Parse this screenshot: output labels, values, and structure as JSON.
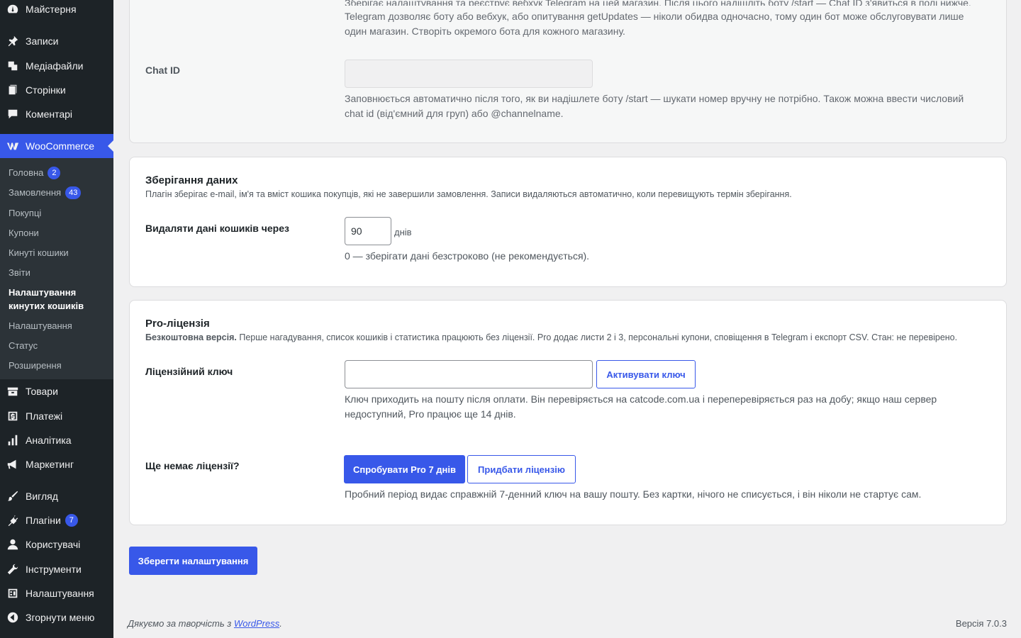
{
  "menu": {
    "dashboard": "Майстерня",
    "posts": "Записи",
    "media": "Медіафайли",
    "pages": "Сторінки",
    "comments": "Коментарі",
    "woocommerce": "WooCommerce",
    "woo_sub": [
      {
        "label": "Головна",
        "badge": "2"
      },
      {
        "label": "Замовлення",
        "badge": "43"
      },
      {
        "label": "Покупці"
      },
      {
        "label": "Купони"
      },
      {
        "label": "Кинуті кошики"
      },
      {
        "label": "Звіти"
      },
      {
        "label": "Налаштування кинутих кошиків",
        "line1": "Налаштування",
        "line2": "кинутих кошиків"
      },
      {
        "label": "Налаштування"
      },
      {
        "label": "Статус"
      },
      {
        "label": "Розширення"
      }
    ],
    "products": "Товари",
    "payments": "Платежі",
    "analytics": "Аналітика",
    "marketing": "Маркетинг",
    "appearance": "Вигляд",
    "plugins": "Плагіни",
    "plugins_badge": "7",
    "users": "Користувачі",
    "tools": "Інструменти",
    "settings": "Налаштування",
    "collapse": "Згорнути меню"
  },
  "telegram": {
    "top_desc_line0": "Зберігає налаштування та реєструє вебхук Telegram на цей магазин. Після цього надішліть боту /start — Chat ID з'явиться в полі нижче.",
    "top_desc_line1": "Telegram дозволяє боту або вебхук, або опитування getUpdates — ніколи обидва одночасно, тому один бот може обслуговувати лише",
    "top_desc_line2": "один магазин. Створіть окремого бота для кожного магазину.",
    "chat_id_label": "Chat ID",
    "chat_id_value": "",
    "chat_id_desc_line1": "Заповнюється автоматично після того, як ви надішлете боту /start — шукати номер вручну не потрібно. Також можна ввести числовий",
    "chat_id_desc_line2": "chat id (від'ємний для груп) або @channelname."
  },
  "storage": {
    "title": "Зберігання даних",
    "subtitle": "Плагін зберігає e-mail, ім'я та вміст кошика покупців, які не завершили замовлення. Записи видаляються автоматично, коли перевищують термін зберігання.",
    "delete_label": "Видаляти дані кошиків через",
    "delete_value": "90",
    "unit": "днів",
    "hint": "0 — зберігати дані безстроково (не рекомендується)."
  },
  "license": {
    "title": "Pro-ліцензія",
    "status_bold": "Безкоштовна версія.",
    "status_text": " Перше нагадування, список кошиків і статистика працюють без ліцензії. Pro додає листи 2 і 3, персональні купони, сповіщення в Telegram і експорт CSV. Стан: не перевірено.",
    "key_label": "Ліцензійний ключ",
    "key_value": "",
    "activate_button": "Активувати ключ",
    "key_desc_line1": "Ключ приходить на пошту після оплати. Він перевіряється на catcode.com.ua і переперевіряється раз на добу; якщо наш сервер",
    "key_desc_line2": "недоступний, Pro працює ще 14 днів.",
    "no_license_label": "Ще немає ліцензії?",
    "trial_button": "Спробувати Pro 7 днів",
    "buy_button": "Придбати ліцензію",
    "trial_desc": "Пробний період видає справжній 7-денний ключ на вашу пошту. Без картки, нічого не списується, і він ніколи не стартує сам."
  },
  "save_button": "Зберегти налаштування",
  "footer": {
    "thanks_prefix": "Дякуємо за творчість з ",
    "wp_link": "WordPress",
    "thanks_suffix": ".",
    "version": "Версія 7.0.3"
  },
  "colors": {
    "accent": "#3858e9",
    "sidebar": "#1d2327",
    "submenu": "#2c3338"
  }
}
